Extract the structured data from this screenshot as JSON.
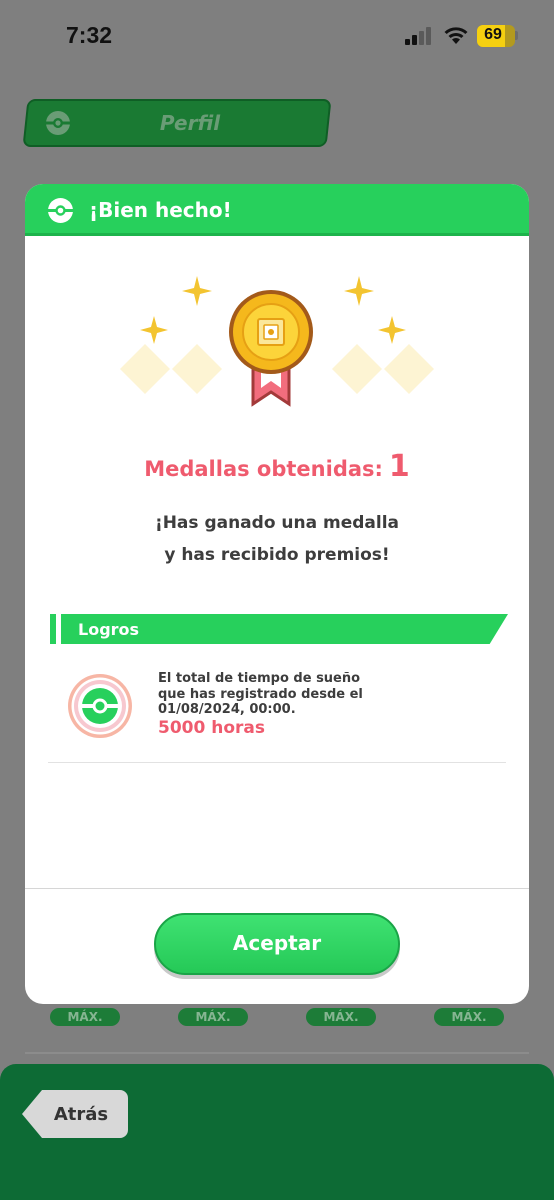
{
  "status_bar": {
    "time": "7:32",
    "battery": "69"
  },
  "background": {
    "tab_label": "Perfil",
    "max_badges": [
      "MÁX.",
      "MÁX.",
      "MÁX.",
      "MÁX."
    ],
    "back_label": "Atrás"
  },
  "dialog": {
    "title": "¡Bien hecho!",
    "medals_label": "Medallas obtenidas:",
    "medals_count": "1",
    "message_line1": "¡Has ganado una medalla",
    "message_line2": "y has recibido premios!",
    "section_title": "Logros",
    "achievement": {
      "line1": "El total de tiempo de sueño",
      "line2": "que has registrado desde el",
      "line3": "01/08/2024, 00:00.",
      "value": "5000 horas"
    },
    "accept_label": "Aceptar"
  },
  "colors": {
    "accent_green": "#27d05c",
    "highlight_red": "#ef5b6e",
    "medal_gold": "#f5b81c",
    "dark_green": "#0d6b35"
  },
  "icons": {
    "ball_icon": "pokeball-icon",
    "medal": "medal-icon",
    "sparkle": "sparkle-icon"
  }
}
